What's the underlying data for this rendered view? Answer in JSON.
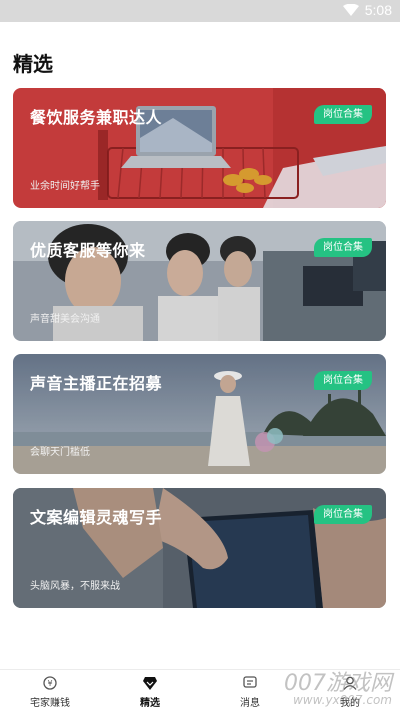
{
  "status_bar": {
    "time": "5:08"
  },
  "page": {
    "title": "精选"
  },
  "cards": [
    {
      "title": "餐饮服务兼职达人",
      "desc": "业余时间好帮手",
      "tag": "岗位合集"
    },
    {
      "title": "优质客服等你来",
      "desc": "声音甜美会沟通",
      "tag": "岗位合集"
    },
    {
      "title": "声音主播正在招募",
      "desc": "会聊天门槛低",
      "tag": "岗位合集"
    },
    {
      "title": "文案编辑灵魂写手",
      "desc": "头脑风暴，不服来战",
      "tag": "岗位合集"
    }
  ],
  "tabbar": {
    "items": [
      {
        "label": "宅家赚钱",
        "icon": "coin-icon"
      },
      {
        "label": "精选",
        "icon": "diamond-icon"
      },
      {
        "label": "消息",
        "icon": "message-icon"
      },
      {
        "label": "我的",
        "icon": "user-icon"
      }
    ]
  },
  "watermark": {
    "line1": "007游戏网",
    "line2": "www.yx007.com"
  },
  "colors": {
    "accent": "#25c283",
    "status_bar": "#d9d9d9"
  }
}
